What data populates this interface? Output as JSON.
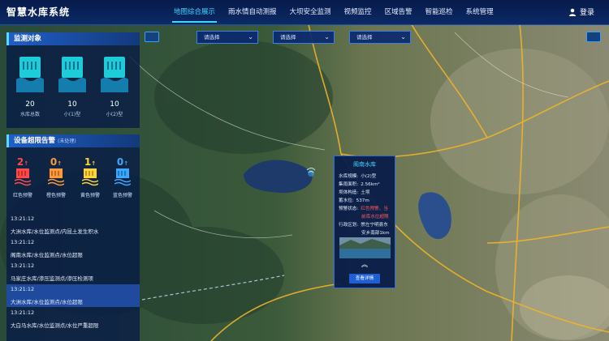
{
  "header": {
    "title": "智慧水库系统",
    "nav": [
      "地图综合展示",
      "雨水情自动测报",
      "大坝安全监测",
      "视频监控",
      "区域告警",
      "智能巡检",
      "系统管理"
    ],
    "active_nav": 0,
    "login": "登录"
  },
  "monitor": {
    "title": "监测对象",
    "cards": [
      {
        "count": "20",
        "label": "水库总数"
      },
      {
        "count": "10",
        "label": "小(1)型"
      },
      {
        "count": "10",
        "label": "小(2)型"
      }
    ]
  },
  "alarm": {
    "title": "设备超限告警",
    "subtitle": "(未处理)",
    "items": [
      {
        "count": "2",
        "label": "红色预警",
        "color": "#ff4a4a"
      },
      {
        "count": "0",
        "label": "橙色预警",
        "color": "#ff9a3a"
      },
      {
        "count": "1",
        "label": "黄色预警",
        "color": "#ffd23a"
      },
      {
        "count": "0",
        "label": "蓝色预警",
        "color": "#3aa8ff"
      }
    ]
  },
  "logs": [
    {
      "time": "13:21:12",
      "text": "大洲水库/水位监测点/内昆土发生积水"
    },
    {
      "time": "13:21:12",
      "text": "阁南水库/水位监测点/水位超限"
    },
    {
      "time": "13:21:12",
      "text": "马家庄水库/渗压监测点/渗压检测项"
    },
    {
      "time": "13:21:12",
      "text": "大洲水库/水位监测点/水位超限"
    },
    {
      "time": "13:21:12",
      "text": "大白马水库/水位监测点/水位严重超限"
    }
  ],
  "selects": [
    "请选择",
    "请选择",
    "请选择"
  ],
  "popup": {
    "title": "阁南水库",
    "rows": [
      {
        "k": "水库规模:",
        "v": "小(2)型"
      },
      {
        "k": "集雨面积:",
        "v": "2.56km²"
      },
      {
        "k": "坝体构造:",
        "v": "土坝"
      },
      {
        "k": "蓄水位:",
        "v": "537m"
      },
      {
        "k": "预警状态:",
        "v": "红色预警、当"
      },
      {
        "k": "",
        "v": "前库水位超限"
      },
      {
        "k": "行政区划:",
        "v": "崇左宁明县东"
      },
      {
        "k": "",
        "v": "安乡南部1km"
      }
    ],
    "detail": "查看详情"
  },
  "colors": {
    "accent": "#40d7ff",
    "header_bg": "#0b2a66",
    "panel_title": "#1f5fc8",
    "highlight_row": "#2658be"
  }
}
